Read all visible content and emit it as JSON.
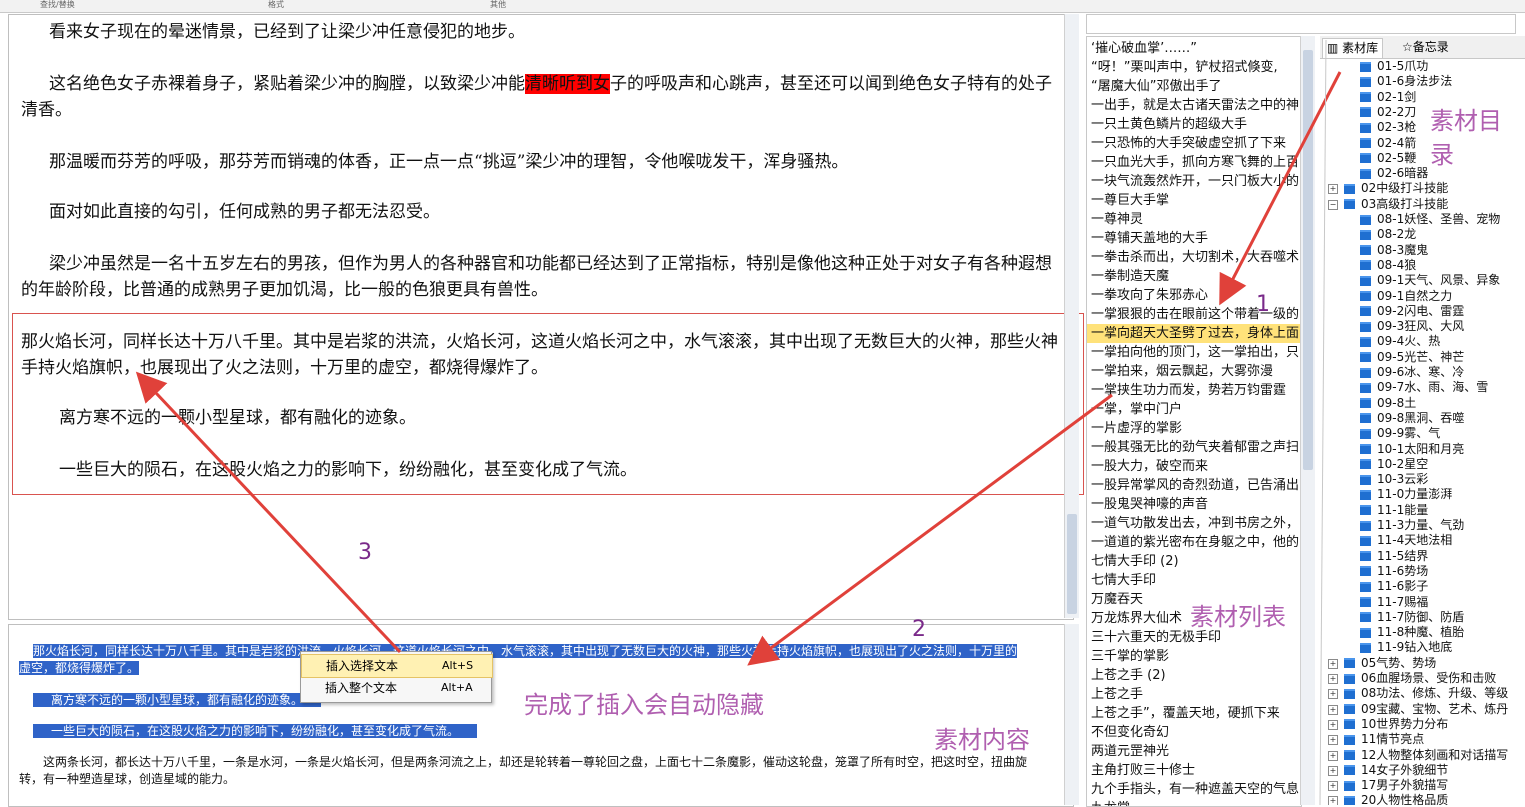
{
  "ribbon": {
    "labels": [
      "查找/替换",
      "格式",
      "其他"
    ]
  },
  "editor": {
    "paragraphs": [
      {
        "text": "看来女子现在的晕迷情景，已经到了让梁少冲任意侵犯的地步。"
      },
      {
        "pre": "这名绝色女子赤裸着身子，紧贴着梁少冲的胸膛，以致梁少冲能",
        "highlight": "清晰听到女",
        "post": "子的呼吸声和心跳声，甚至还可以闻到绝色女子特有的处子清香。"
      },
      {
        "text": "那温暖而芬芳的呼吸，那芬芳而销魂的体香，正一点一点“挑逗”梁少冲的理智，令他喉咙发干，浑身骚热。"
      },
      {
        "text": "面对如此直接的勾引，任何成熟的男子都无法忍受。"
      },
      {
        "text": "梁少冲虽然是一名十五岁左右的男孩，但作为男人的各种器官和功能都已经达到了正常指标，特别是像他这种正处于对女子有各种遐想的年龄阶段，比普通的成熟男子更加饥渴，比一般的色狼更具有兽性。"
      }
    ],
    "inserted": [
      "那火焰长河，同样长达十万八千里。其中是岩浆的洪流，火焰长河，这道火焰长河之中，水气滚滚，其中出现了无数巨大的火神，那些火神手持火焰旗帜，也展现出了火之法则，十万里的虚空，都烧得爆炸了。",
      "离方寒不远的一颗小型星球，都有融化的迹象。",
      "一些巨大的陨石，在这股火焰之力的影响下，纷纷融化，甚至变化成了气流。"
    ]
  },
  "content_pane": {
    "selected_lines": [
      "那火焰长河，同样长达十万八千里。其中是岩浆的洪流，火焰长河，这道火焰长河之中，水气滚滚，其中出现了无数巨大的火神，那些火神手持火焰旗帜，也展现出了火之法则，十万里的",
      "虚空，都烧得爆炸了。",
      "离方寒不远的一颗小型星球，都有融化的迹象。",
      "一些巨大的陨石，在这股火焰之力的影响下，纷纷融化，甚至变化成了气流。"
    ],
    "normal_lines": [
      "这两条长河，都长达十万八千里，一条是水河，一条是火焰长河，但是两条河流之上，却还是轮转着一尊轮回之盘，上面七十二条魔影，催动这轮盘，笼罩了所有时空，把这时空，扭曲旋",
      "转，有一种塑造星球，创造星域的能力。"
    ]
  },
  "context_menu": {
    "items": [
      {
        "label": "插入选择文本",
        "shortcut": "Alt+S"
      },
      {
        "label": "插入整个文本",
        "shortcut": "Alt+A"
      }
    ]
  },
  "material_list": {
    "items": [
      "‘摧心破血掌’……”",
      "“呀！”栗叫声中，铲杖招式倏变,",
      "“屠魔大仙”邓傲出手了",
      "一出手，就是太古诸天雷法之中的神",
      "一只土黄色鳞片的超级大手",
      "一只恐怖的大手突破虚空抓了下来",
      "一只血光大手，抓向方寒飞舞的上百",
      "一块气流轰然炸开，一只门板大小的",
      "一尊巨大手掌",
      "一尊神灵",
      "一尊铺天盖地的大手",
      "一拳击杀而出，大切割术，大吞噬术",
      "一拳制造天魔",
      "一拳攻向了朱邪赤心",
      "一掌狠狠的击在眼前这个带着一级的",
      "一掌向超天大圣劈了过去，身体上面",
      "一掌拍向他的顶门，这一掌拍出，只",
      "一掌拍来，烟云飘起，大雾弥漫",
      "一掌挟生功力而发，势若万钧雷霆",
      "一掌，掌中门户",
      "一片虚浮的掌影",
      "一般其强无比的劲气夹着郁雷之声扫",
      "一股大力，破空而来",
      "一股异常掌风的奇烈劲道，已告涌出",
      "一股鬼哭神嚎的声音",
      "一道气功散发出去，冲到书房之外，",
      "一道道的紫光密布在身躯之中，他的",
      "七情大手印 (2)",
      "七情大手印",
      "万魔吞天",
      "万龙炼界大仙术",
      "三十六重天的无极手印",
      "三千掌的掌影",
      "上苍之手 (2)",
      "上苍之手",
      "上苍之手”，覆盖天地，硬抓下来",
      "不但变化奇幻",
      "两道元罡神光",
      "主角打败三十修士",
      "九个手指头，有一种遮盖天空的气息",
      "九龙掌"
    ],
    "selected_index": 15
  },
  "tree": {
    "tabs": [
      "素材库",
      "备忘录"
    ],
    "nodes": [
      {
        "label": "01-5爪功",
        "level": 2
      },
      {
        "label": "01-6身法步法",
        "level": 2
      },
      {
        "label": "02-1剑",
        "level": 2
      },
      {
        "label": "02-2刀",
        "level": 2
      },
      {
        "label": "02-3枪",
        "level": 2
      },
      {
        "label": "02-4箭",
        "level": 2
      },
      {
        "label": "02-5鞭",
        "level": 2
      },
      {
        "label": "02-6暗器",
        "level": 2
      },
      {
        "label": "02中级打斗技能",
        "level": 1,
        "expander": "+"
      },
      {
        "label": "03高级打斗技能",
        "level": 1,
        "expander": "−"
      },
      {
        "label": "08-1妖怪、圣兽、宠物",
        "level": 2
      },
      {
        "label": "08-2龙",
        "level": 2
      },
      {
        "label": "08-3魔鬼",
        "level": 2
      },
      {
        "label": "08-4狼",
        "level": 2
      },
      {
        "label": "09-1天气、风景、异象",
        "level": 2
      },
      {
        "label": "09-1自然之力",
        "level": 2
      },
      {
        "label": "09-2闪电、雷霆",
        "level": 2
      },
      {
        "label": "09-3狂风、大风",
        "level": 2
      },
      {
        "label": "09-4火、热",
        "level": 2
      },
      {
        "label": "09-5光芒、神芒",
        "level": 2
      },
      {
        "label": "09-6冰、寒、冷",
        "level": 2
      },
      {
        "label": "09-7水、雨、海、雪",
        "level": 2
      },
      {
        "label": "09-8土",
        "level": 2
      },
      {
        "label": "09-8黑洞、吞噬",
        "level": 2
      },
      {
        "label": "09-9雾、气",
        "level": 2
      },
      {
        "label": "10-1太阳和月亮",
        "level": 2
      },
      {
        "label": "10-2星空",
        "level": 2
      },
      {
        "label": "10-3云彩",
        "level": 2
      },
      {
        "label": "11-0力量澎湃",
        "level": 2
      },
      {
        "label": "11-1能量",
        "level": 2
      },
      {
        "label": "11-3力量、气劲",
        "level": 2
      },
      {
        "label": "11-4天地法相",
        "level": 2
      },
      {
        "label": "11-5结界",
        "level": 2
      },
      {
        "label": "11-6势场",
        "level": 2
      },
      {
        "label": "11-6影子",
        "level": 2
      },
      {
        "label": "11-7赐福",
        "level": 2
      },
      {
        "label": "11-7防御、防盾",
        "level": 2
      },
      {
        "label": "11-8种魔、植胎",
        "level": 2
      },
      {
        "label": "11-9钻入地底",
        "level": 2
      },
      {
        "label": "05气势、势场",
        "level": 1,
        "expander": "+"
      },
      {
        "label": "06血腥场景、受伤和击败",
        "level": 1,
        "expander": "+"
      },
      {
        "label": "08功法、修炼、升级、等级",
        "level": 1,
        "expander": "+"
      },
      {
        "label": "09宝藏、宝物、艺术、炼丹",
        "level": 1,
        "expander": "+"
      },
      {
        "label": "10世界势力分布",
        "level": 1,
        "expander": "+"
      },
      {
        "label": "11情节亮点",
        "level": 1,
        "expander": "+"
      },
      {
        "label": "12人物整体刻画和对话描写",
        "level": 1,
        "expander": "+"
      },
      {
        "label": "14女子外貌细节",
        "level": 1,
        "expander": "+"
      },
      {
        "label": "17男子外貌描写",
        "level": 1,
        "expander": "+"
      },
      {
        "label": "20人物性格品质",
        "level": 1,
        "expander": "+"
      }
    ]
  },
  "annotations": {
    "material_dir": "素材目录",
    "material_list": "素材列表",
    "material_content": "素材内容",
    "auto_hide": "完成了插入会自动隐藏",
    "n1": "1",
    "n2": "2",
    "n3": "3"
  },
  "colors": {
    "highlight": "#ff0000",
    "selection": "#2f63c8",
    "list_selected": "#ffe27a",
    "arrow": "#e0413a",
    "annotation": "#b05fb0"
  }
}
